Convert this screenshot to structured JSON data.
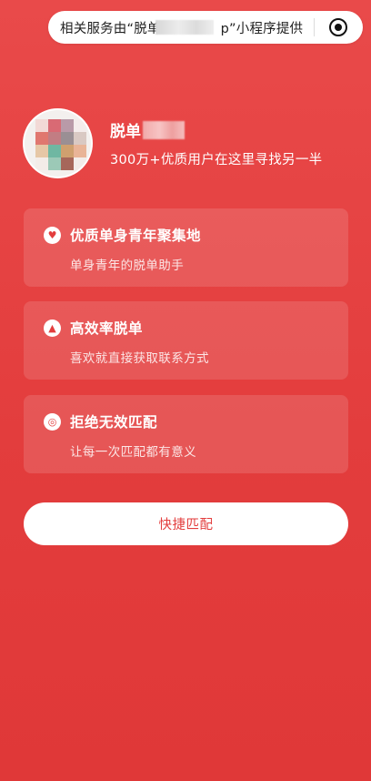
{
  "notice_bar": {
    "text_prefix": "相关服务由“脱单",
    "text_suffix": "p”小程序提供",
    "target_icon": "target-icon"
  },
  "profile": {
    "name_prefix": "脱单",
    "subtitle": "300万+优质用户在这里寻找另一半"
  },
  "features": [
    {
      "icon": "heart-badge-icon",
      "title": "优质单身青年聚集地",
      "desc": "单身青年的脱单助手"
    },
    {
      "icon": "rocket-badge-icon",
      "title": "高效率脱单",
      "desc": "喜欢就直接获取联系方式"
    },
    {
      "icon": "target-badge-icon",
      "title": "拒绝无效匹配",
      "desc": "让每一次匹配都有意义"
    }
  ],
  "cta": {
    "label": "快捷匹配"
  },
  "colors": {
    "background": "#e33d3d",
    "accent": "#e33d3d",
    "card": "rgba(255,255,255,0.13)"
  }
}
